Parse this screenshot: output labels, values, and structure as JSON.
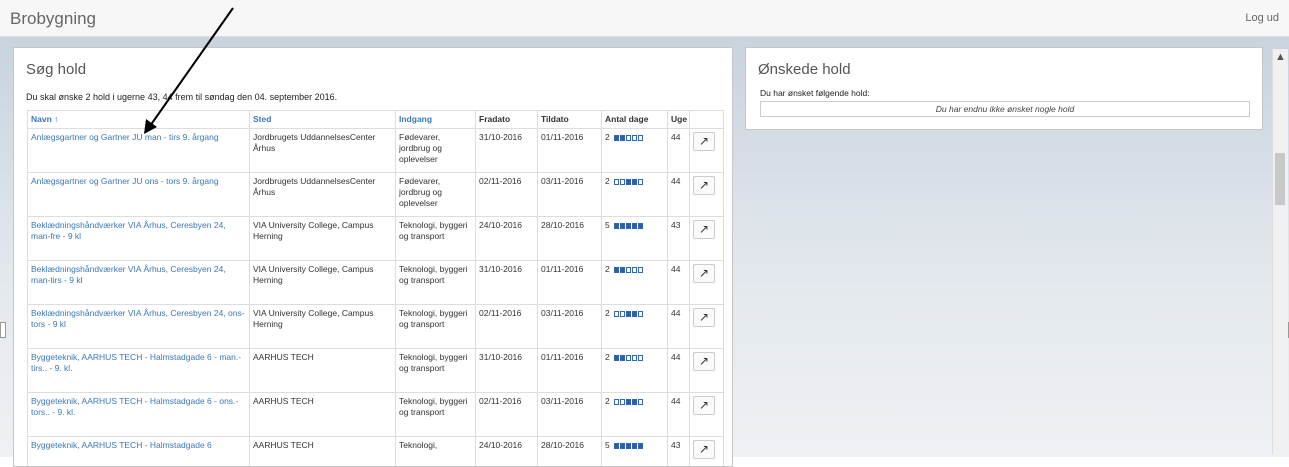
{
  "header": {
    "title": "Brobygning",
    "logout": "Log ud"
  },
  "search": {
    "title": "Søg hold",
    "intro": "Du skal ønske 2 hold i ugerne 43, 44 frem til søndag den 04. september 2016.",
    "columns": [
      "Navn ↑",
      "Sted",
      "Indgang",
      "Fradato",
      "Tildato",
      "Antal dage",
      "Uge"
    ],
    "rows": [
      {
        "navn": "Anlægsgartner og Gartner JU man - tirs 9. årgang",
        "sted": "Jordbrugets UddannelsesCenter Århus",
        "indgang": "Fødevarer, jordbrug og oplevelser",
        "fra": "31/10-2016",
        "til": "01/11-2016",
        "dage": "2",
        "uge": "44",
        "pattern": [
          1,
          1,
          0,
          0,
          0
        ]
      },
      {
        "navn": "Anlægsgartner og Gartner JU ons - tors 9. årgang",
        "sted": "Jordbrugets UddannelsesCenter Århus",
        "indgang": "Fødevarer, jordbrug og oplevelser",
        "fra": "02/11-2016",
        "til": "03/11-2016",
        "dage": "2",
        "uge": "44",
        "pattern": [
          0,
          0,
          1,
          1,
          0
        ]
      },
      {
        "navn": "Beklædningshåndværker VIA Århus, Ceresbyen 24, man-fre - 9 kl",
        "sted": "VIA University College, Campus Herning",
        "indgang": "Teknologi, byggeri og transport",
        "fra": "24/10-2016",
        "til": "28/10-2016",
        "dage": "5",
        "uge": "43",
        "pattern": [
          1,
          1,
          1,
          1,
          1
        ]
      },
      {
        "navn": "Beklædningshåndværker VIA Århus, Ceresbyen 24, man-tirs - 9 kl",
        "sted": "VIA University College, Campus Herning",
        "indgang": "Teknologi, byggeri og transport",
        "fra": "31/10-2016",
        "til": "01/11-2016",
        "dage": "2",
        "uge": "44",
        "pattern": [
          1,
          1,
          0,
          0,
          0
        ]
      },
      {
        "navn": "Beklædningshåndværker VIA Århus, Ceresbyen 24, ons-tors - 9 kl",
        "sted": "VIA University College, Campus Herning",
        "indgang": "Teknologi, byggeri og transport",
        "fra": "02/11-2016",
        "til": "03/11-2016",
        "dage": "2",
        "uge": "44",
        "pattern": [
          0,
          0,
          1,
          1,
          0
        ]
      },
      {
        "navn": "Byggeteknik, AARHUS TECH - Halmstadgade 6 - man.- tirs.. - 9. kl.",
        "sted": "AARHUS TECH",
        "indgang": "Teknologi, byggeri og transport",
        "fra": "31/10-2016",
        "til": "01/11-2016",
        "dage": "2",
        "uge": "44",
        "pattern": [
          1,
          1,
          0,
          0,
          0
        ]
      },
      {
        "navn": "Byggeteknik, AARHUS TECH - Halmstadgade 6 - ons.- tors.. - 9. kl.",
        "sted": "AARHUS TECH",
        "indgang": "Teknologi, byggeri og transport",
        "fra": "02/11-2016",
        "til": "03/11-2016",
        "dage": "2",
        "uge": "44",
        "pattern": [
          0,
          0,
          1,
          1,
          0
        ]
      },
      {
        "navn": "Byggeteknik, AARHUS TECH - Halmstadgade 6",
        "sted": "AARHUS TECH",
        "indgang": "Teknologi,",
        "fra": "24/10-2016",
        "til": "28/10-2016",
        "dage": "5",
        "uge": "43",
        "pattern": [
          1,
          1,
          1,
          1,
          1
        ]
      }
    ]
  },
  "wishes": {
    "title": "Ønskede hold",
    "label": "Du har ønsket følgende hold:",
    "empty": "Du har endnu ikke ønsket nogle hold"
  },
  "icons": {
    "action": "external-link-icon",
    "sort": "sort-up-icon"
  },
  "colors": {
    "link": "#3a78b8",
    "day_on": "#2b5ea8",
    "arrow": "#000000"
  }
}
